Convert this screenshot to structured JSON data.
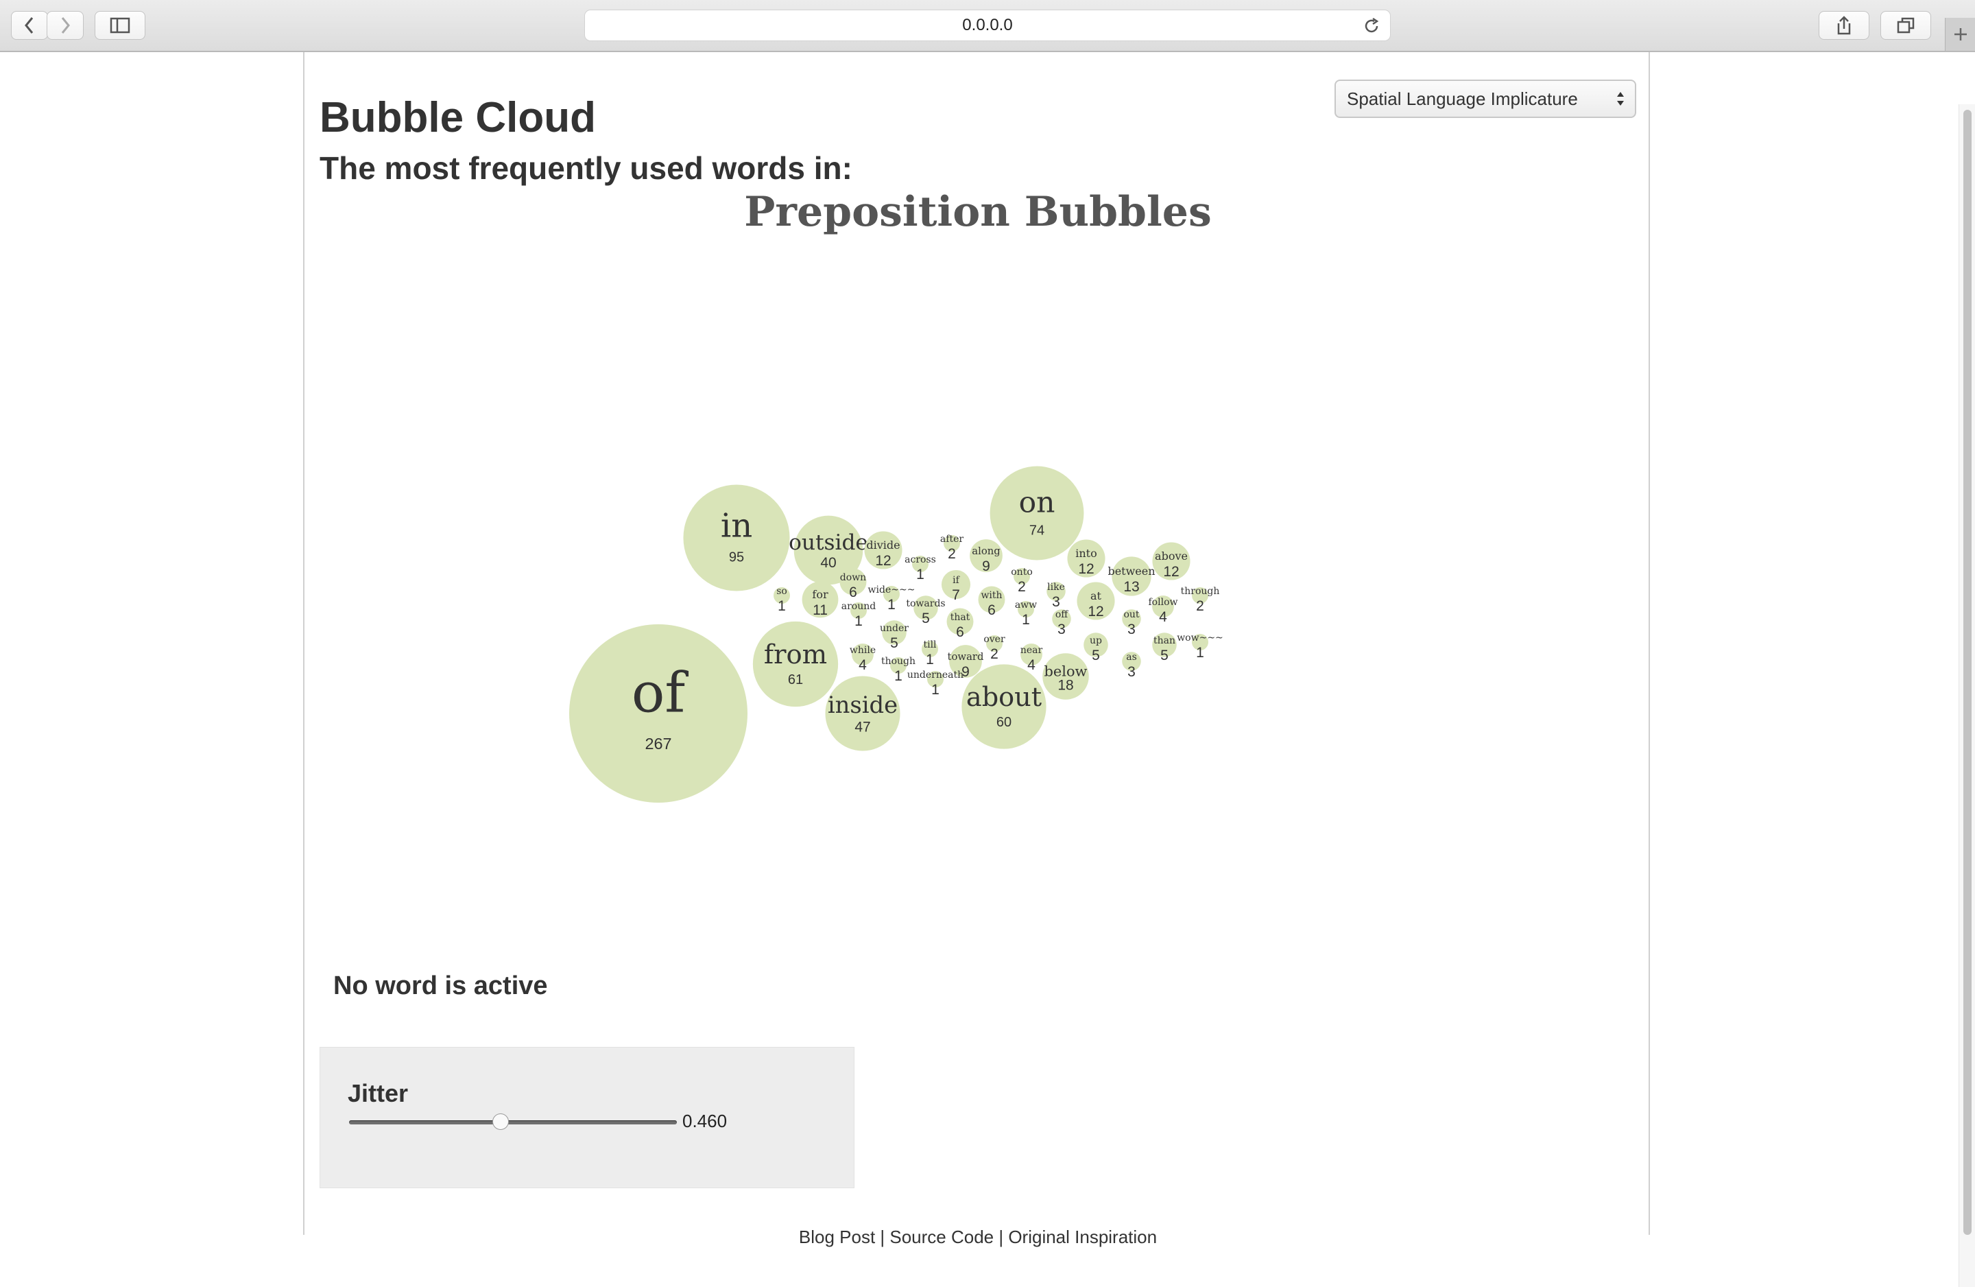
{
  "browser": {
    "address": "0.0.0.0",
    "icons": [
      "back-icon",
      "forward-icon",
      "sidebar-icon",
      "reload-icon",
      "share-icon",
      "tabs-icon",
      "new-tab-icon"
    ]
  },
  "page": {
    "title": "Bubble Cloud",
    "subtitle": "The most frequently used words in:",
    "select": {
      "selected": "Spatial Language Implicature"
    },
    "vis_title": "Preposition Bubbles",
    "status": "No word is active",
    "jitter": {
      "label": "Jitter",
      "value": 0.46,
      "value_text": "0.460",
      "min": 0,
      "max": 1
    },
    "footer": "Blog Post | Source Code | Original Inspiration"
  },
  "colors": {
    "bubble": "#d9e4b8",
    "text": "#333333"
  },
  "bubbles": [
    {
      "word": "of",
      "count": 267
    },
    {
      "word": "in",
      "count": 95
    },
    {
      "word": "on",
      "count": 74
    },
    {
      "word": "from",
      "count": 61
    },
    {
      "word": "about",
      "count": 60
    },
    {
      "word": "inside",
      "count": 47
    },
    {
      "word": "outside",
      "count": 40
    },
    {
      "word": "below",
      "count": 18
    },
    {
      "word": "between",
      "count": 13
    },
    {
      "word": "divide",
      "count": 12
    },
    {
      "word": "into",
      "count": 12
    },
    {
      "word": "above",
      "count": 12
    },
    {
      "word": "at",
      "count": 12
    },
    {
      "word": "for",
      "count": 11
    },
    {
      "word": "along",
      "count": 9
    },
    {
      "word": "toward",
      "count": 9
    },
    {
      "word": "if",
      "count": 7
    },
    {
      "word": "down",
      "count": 6
    },
    {
      "word": "with",
      "count": 6
    },
    {
      "word": "that",
      "count": 6
    },
    {
      "word": "towards",
      "count": 5
    },
    {
      "word": "under",
      "count": 5
    },
    {
      "word": "up",
      "count": 5
    },
    {
      "word": "than",
      "count": 5
    },
    {
      "word": "while",
      "count": 4
    },
    {
      "word": "near",
      "count": 4
    },
    {
      "word": "follow",
      "count": 4
    },
    {
      "word": "like",
      "count": 3
    },
    {
      "word": "off",
      "count": 3
    },
    {
      "word": "out",
      "count": 3
    },
    {
      "word": "as",
      "count": 3
    },
    {
      "word": "after",
      "count": 2
    },
    {
      "word": "onto",
      "count": 2
    },
    {
      "word": "over",
      "count": 2
    },
    {
      "word": "through",
      "count": 2
    },
    {
      "word": "so",
      "count": 1
    },
    {
      "word": "across",
      "count": 1
    },
    {
      "word": "wide~~~",
      "count": 1
    },
    {
      "word": "around",
      "count": 1
    },
    {
      "word": "till",
      "count": 1
    },
    {
      "word": "though",
      "count": 1
    },
    {
      "word": "underneath",
      "count": 1
    },
    {
      "word": "aww",
      "count": 1
    },
    {
      "word": "wow~~~",
      "count": 1
    }
  ]
}
